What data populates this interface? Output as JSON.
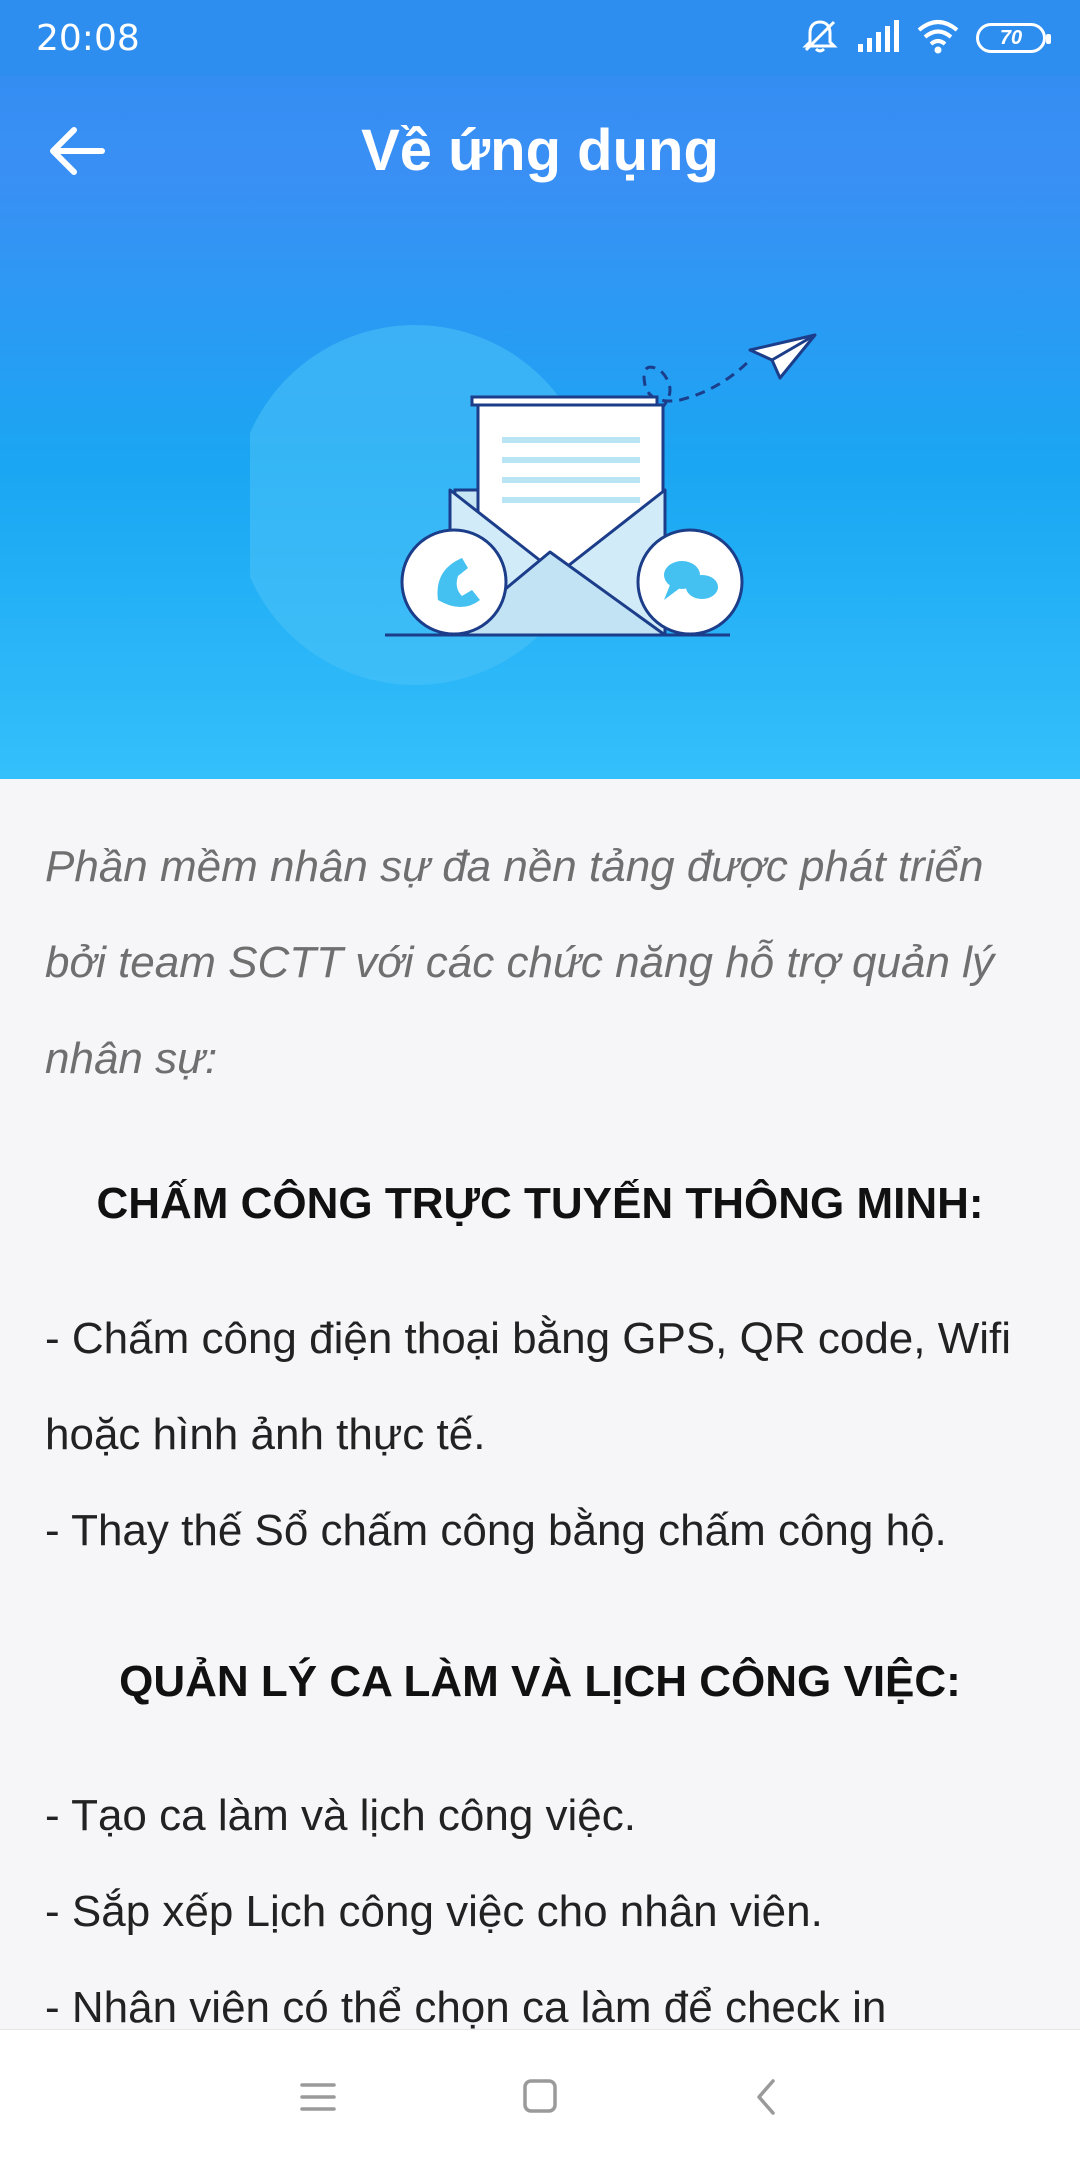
{
  "status_bar": {
    "time": "20:08",
    "battery": "70",
    "icons": [
      "mute-icon",
      "signal-icon",
      "wifi-icon",
      "battery-icon"
    ]
  },
  "app_bar": {
    "title": "Về ứng dụng",
    "back_icon": "back-arrow-icon"
  },
  "hero": {
    "illustration": "envelope-letter-illustration",
    "colors": {
      "top": "#2f8ef0",
      "bottom": "#34c0fb"
    }
  },
  "content": {
    "intro": "Phần mềm nhân sự đa nền tảng được phát triển bởi team SCTT với các chức năng hỗ trợ quản lý nhân sự:",
    "sections": [
      {
        "heading": "CHẤM CÔNG TRỰC TUYẾN THÔNG MINH:",
        "items": [
          "- Chấm công điện thoại bằng GPS, QR code, Wifi hoặc hình ảnh thực tế.",
          "- Thay thế Sổ chấm công bằng chấm công hộ."
        ]
      },
      {
        "heading": "QUẢN LÝ CA LÀM VÀ LỊCH CÔNG VIỆC:",
        "items": [
          "- Tạo ca làm và lịch công việc.",
          "- Sắp xếp Lịch công việc cho nhân viên.",
          "- Nhân viên có thể chọn ca làm để check in"
        ]
      }
    ]
  },
  "nav_bar": {
    "buttons": [
      "menu-icon",
      "home-icon",
      "back-icon"
    ]
  }
}
